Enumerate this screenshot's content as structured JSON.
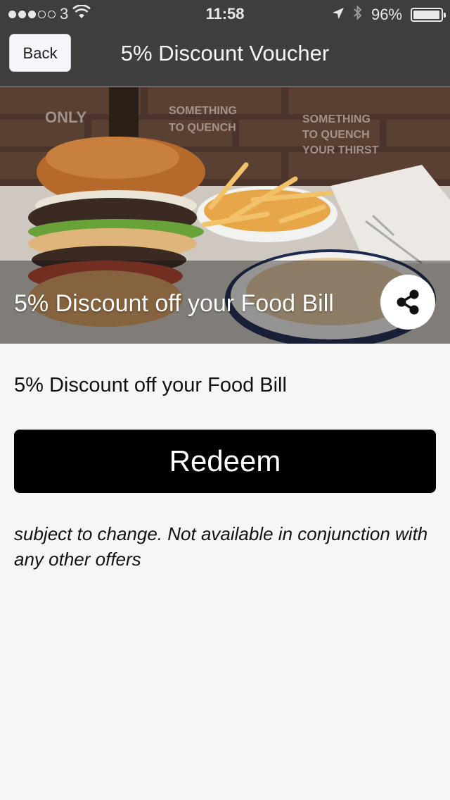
{
  "status_bar": {
    "carrier": "3",
    "time": "11:58",
    "battery": "96%",
    "signal_dots_filled": 3,
    "signal_dots_total": 5,
    "battery_level": 0.96,
    "icons": [
      "wifi-icon",
      "location-arrow-icon",
      "bluetooth-icon",
      "battery-icon"
    ]
  },
  "nav": {
    "back_label": "Back",
    "title": "5% Discount Voucher"
  },
  "hero": {
    "caption": "5% Discount off your Food Bill",
    "share_icon": "share-icon"
  },
  "content": {
    "title": "5% Discount off your Food Bill",
    "redeem_label": "Redeem",
    "terms": "subject to change. Not available in conjunction with any other offers"
  },
  "colors": {
    "header_bg": "#3e3e3e",
    "page_bg": "#f6f6f6",
    "button_bg": "#000000",
    "button_text": "#ffffff"
  }
}
